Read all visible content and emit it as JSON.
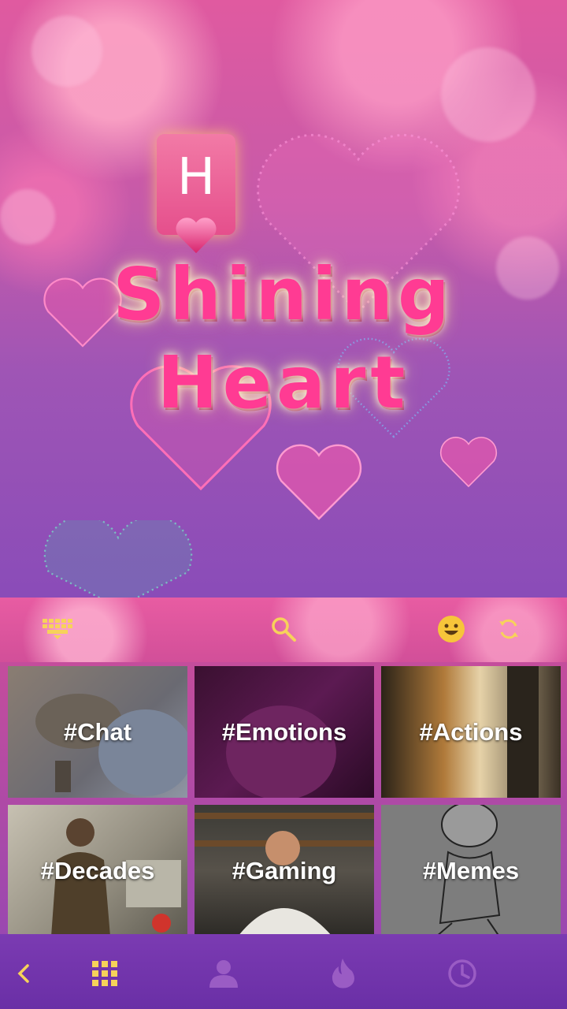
{
  "theme": {
    "title_line1": "Shining",
    "title_line2": "Heart",
    "logo_letter": "H"
  },
  "toolbar": {
    "icons": [
      "keyboard-icon",
      "search-icon",
      "emoji-icon",
      "refresh-icon"
    ]
  },
  "categories": [
    {
      "label": "#Chat"
    },
    {
      "label": "#Emotions"
    },
    {
      "label": "#Actions"
    },
    {
      "label": "#Decades"
    },
    {
      "label": "#Gaming"
    },
    {
      "label": "#Memes"
    }
  ],
  "bottom_nav": {
    "icons": [
      "back-chevron-icon",
      "grid-icon",
      "person-icon",
      "fire-icon",
      "clock-icon"
    ],
    "active": "grid-icon"
  },
  "colors": {
    "accent_yellow": "#f7d25a",
    "title_pink": "#ff3b93",
    "nav_inactive": "#9a5cc4"
  }
}
